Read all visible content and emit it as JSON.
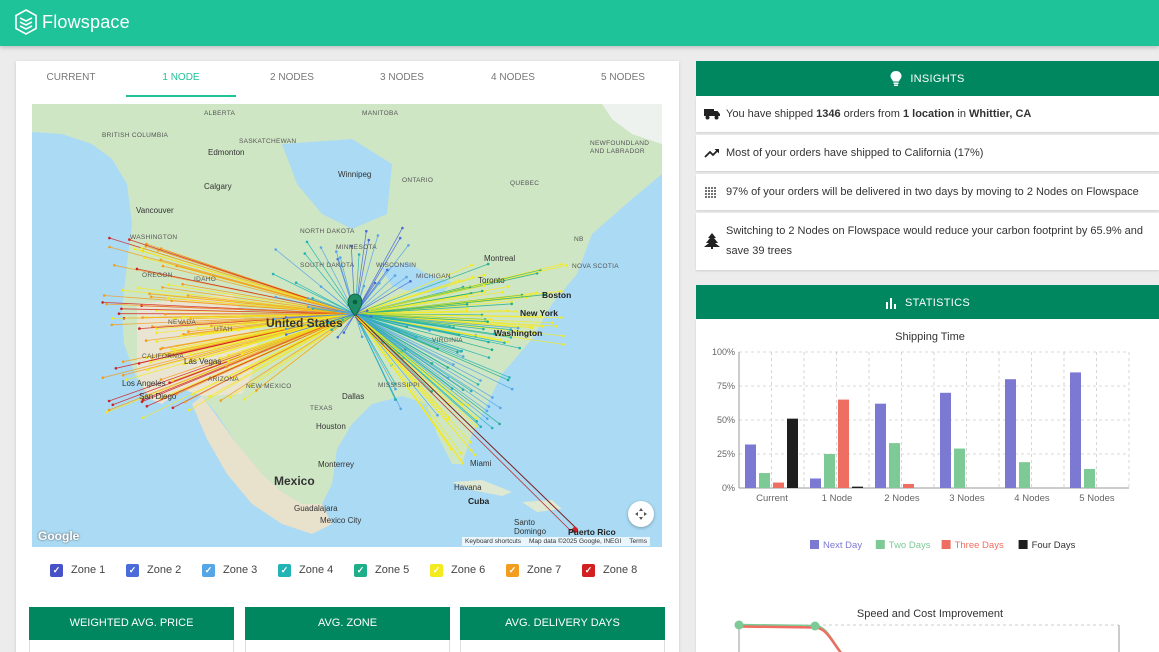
{
  "header": {
    "brand": "Flowspace"
  },
  "tabs": [
    {
      "label": "CURRENT",
      "active": false
    },
    {
      "label": "1 NODE",
      "active": true
    },
    {
      "label": "2 NODES",
      "active": false
    },
    {
      "label": "3 NODES",
      "active": false
    },
    {
      "label": "4 NODES",
      "active": false
    },
    {
      "label": "5 NODES",
      "active": false
    }
  ],
  "map": {
    "labels": {
      "alberta": "ALBERTA",
      "manitoba": "MANITOBA",
      "saskatchewan": "SASKATCHEWAN",
      "british_columbia": "BRITISH COLUMBIA",
      "ontario": "ONTARIO",
      "quebec": "QUEBEC",
      "newfoundland": "NEWFOUNDLAND AND LABRADOR",
      "edmonton": "Edmonton",
      "calgary": "Calgary",
      "vancouver": "Vancouver",
      "winnipeg": "Winnipeg",
      "washington_state": "WASHINGTON",
      "oregon": "OREGON",
      "idaho": "IDAHO",
      "nevada": "NEVADA",
      "utah": "UTAH",
      "california": "CALIFORNIA",
      "arizona": "ARIZONA",
      "new_mexico": "NEW MEXICO",
      "texas": "TEXAS",
      "north_dakota": "NORTH DAKOTA",
      "south_dakota": "SOUTH DAKOTA",
      "minnesota": "MINNESOTA",
      "wisconsin": "WISCONSIN",
      "michigan": "MICHIGAN",
      "virginia": "VIRGINIA",
      "mississippi": "MISSISSIPPI",
      "united_states": "United States",
      "las_vegas": "Las Vegas",
      "los_angeles": "Los Angeles",
      "san_diego": "San Diego",
      "dallas": "Dallas",
      "houston": "Houston",
      "toronto": "Toronto",
      "montreal": "Montreal",
      "boston": "Boston",
      "new_york": "New York",
      "washington_dc": "Washington",
      "nb": "NB",
      "nova_scotia": "NOVA SCOTIA",
      "monterrey": "Monterrey",
      "mexico": "Mexico",
      "guadalajara": "Guadalajara",
      "mexico_city": "Mexico City",
      "miami": "Miami",
      "havana": "Havana",
      "cuba": "Cuba",
      "santo_domingo": "Santo Domingo",
      "puerto_rico": "Puerto Rico",
      "google": "Google",
      "keyboard": "Keyboard shortcuts",
      "map_data": "Map data ©2025 Google, INEGI",
      "terms": "Terms"
    }
  },
  "zones": [
    {
      "label": "Zone 1",
      "color": "#4652c6"
    },
    {
      "label": "Zone 2",
      "color": "#4a6bd8"
    },
    {
      "label": "Zone 3",
      "color": "#55a6e6"
    },
    {
      "label": "Zone 4",
      "color": "#22b4b4"
    },
    {
      "label": "Zone 5",
      "color": "#1fae8a"
    },
    {
      "label": "Zone 6",
      "color": "#f4ea1e"
    },
    {
      "label": "Zone 7",
      "color": "#f29d1d"
    },
    {
      "label": "Zone 8",
      "color": "#d21f1f"
    }
  ],
  "metrics": [
    {
      "label": "WEIGHTED AVG. PRICE"
    },
    {
      "label": "AVG. ZONE"
    },
    {
      "label": "AVG. DELIVERY DAYS"
    }
  ],
  "insights": {
    "title": "INSIGHTS",
    "row1": {
      "a": "You have shipped ",
      "b": "1346",
      "c": " orders from ",
      "d": "1 location",
      "e": " in ",
      "f": "Whittier, CA"
    },
    "row2": "Most of your orders have shipped to California (17%)",
    "row3": "97% of your orders will be delivered in two days by moving to 2 Nodes on Flowspace",
    "row4": "Switching to 2 Nodes on Flowspace would reduce your carbon footprint by 65.9% and save 39 trees"
  },
  "statistics": {
    "title": "STATISTICS"
  },
  "chart_data": [
    {
      "type": "bar",
      "title": "Shipping Time",
      "categories": [
        "Current",
        "1 Node",
        "2 Nodes",
        "3 Nodes",
        "4 Nodes",
        "5 Nodes"
      ],
      "yticks": [
        "0%",
        "25%",
        "50%",
        "75%",
        "100%"
      ],
      "ylim": [
        0,
        100
      ],
      "grid": true,
      "legend_position": "bottom",
      "series": [
        {
          "name": "Next Day",
          "color": "#7b79d2",
          "values": [
            32,
            7,
            62,
            70,
            80,
            85
          ]
        },
        {
          "name": "Two Days",
          "color": "#7dca96",
          "values": [
            11,
            25,
            33,
            29,
            19,
            14
          ]
        },
        {
          "name": "Three Days",
          "color": "#ef6e62",
          "values": [
            4,
            65,
            3,
            0,
            0,
            0
          ]
        },
        {
          "name": "Four Days",
          "color": "#1e1e1e",
          "values": [
            51,
            1,
            0,
            0,
            0,
            0
          ]
        }
      ]
    },
    {
      "type": "line",
      "title": "Speed and Cost Improvement",
      "series": [
        {
          "color": "#7dca96",
          "values": [
            100,
            100
          ]
        },
        {
          "color": "#ef6e62",
          "values": [
            99,
            99
          ]
        }
      ]
    }
  ]
}
